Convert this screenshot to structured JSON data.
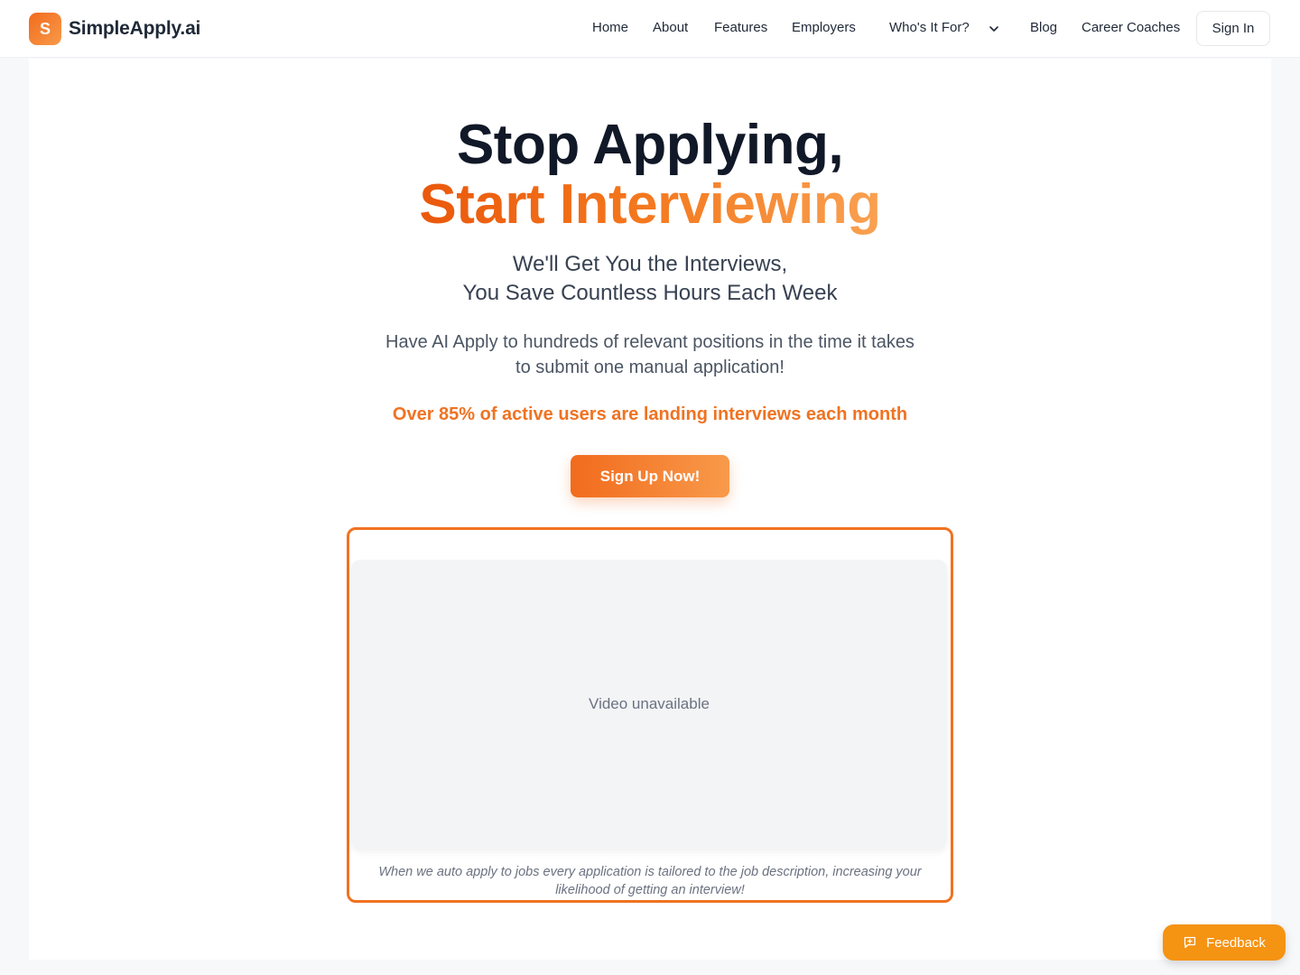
{
  "header": {
    "brand_initial": "S",
    "brand_name": "SimpleApply.ai",
    "nav": {
      "home": "Home",
      "about": "About",
      "features": "Features",
      "employers": "Employers",
      "whos_it_for": "Who's It For?",
      "blog": "Blog",
      "career_coaches": "Career Coaches"
    },
    "sign_in": "Sign In",
    "dropdown_icon": "chevron-down-icon"
  },
  "hero": {
    "title_line1": "Stop Applying,",
    "title_line2": "Start Interviewing",
    "subtitle_line1": "We'll Get You the Interviews,",
    "subtitle_line2": "You Save Countless Hours Each Week",
    "description_line1": "Have AI Apply to hundreds of relevant positions in the time it takes",
    "description_line2": "to submit one manual application!",
    "stat": "Over 85% of active users are landing interviews each month",
    "cta": "Sign Up Now!"
  },
  "video": {
    "status": "Video unavailable",
    "caption_line1": "When we auto apply to jobs every application is tailored to the job description, increasing your",
    "caption_line2": "likelihood of getting an interview!"
  },
  "feedback": {
    "label": "Feedback",
    "icon": "message-plus-icon"
  },
  "colors": {
    "accent": "#f26b1d",
    "accent_light": "#f89a4a",
    "feedback": "#f59313",
    "text_dark": "#111827"
  }
}
